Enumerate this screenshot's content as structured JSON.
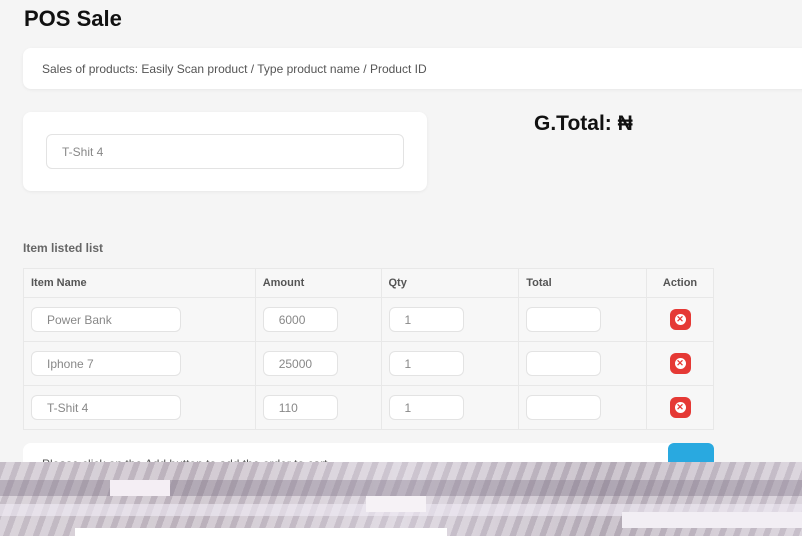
{
  "page": {
    "title": "POS Sale",
    "info": "Sales of products: Easily Scan product / Type product name / Product ID"
  },
  "search": {
    "value": "T-Shit 4"
  },
  "grand_total": {
    "label": "G.Total: ₦"
  },
  "items": {
    "title": "Item listed list",
    "columns": [
      "Item Name",
      "Amount",
      "Qty",
      "Total",
      "Action"
    ],
    "rows": [
      {
        "name": "Power Bank",
        "amount": "6000",
        "qty": "1",
        "total": ""
      },
      {
        "name": "Iphone 7",
        "amount": "25000",
        "qty": "1",
        "total": ""
      },
      {
        "name": "T-Shit 4",
        "amount": "110",
        "qty": "1",
        "total": ""
      }
    ]
  },
  "note": {
    "text": "Please click on the Add button to add the order to cart"
  },
  "colors": {
    "remove": "#e53935",
    "add_button": "#29a9e0"
  },
  "icons": {
    "remove": "close-circle-icon"
  }
}
